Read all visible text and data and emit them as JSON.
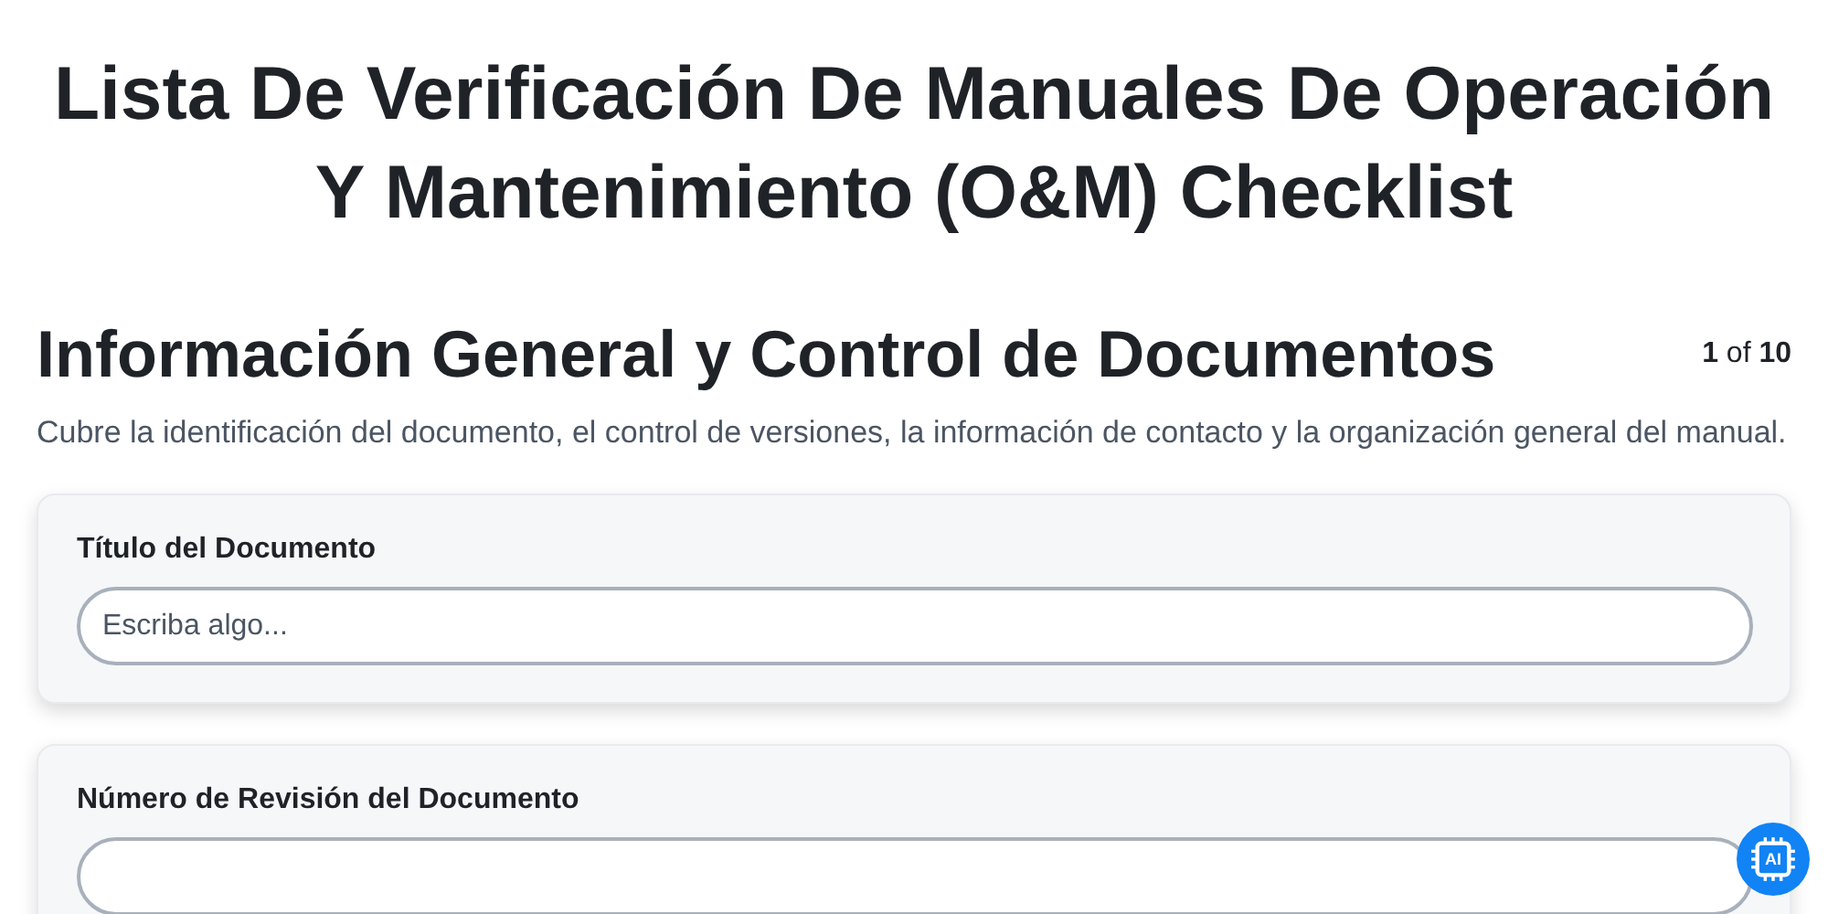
{
  "title": "Lista De Verificación De Manuales De Operación Y Mantenimiento (O&M) Checklist",
  "section": {
    "heading": "Información General y Control de Documentos",
    "progress": "**1** of **10**",
    "description": "Cubre la identificación del documento, el control de versiones, la información de contacto y la organización general del manual."
  },
  "questions": [
    {
      "label": "Título del Documento",
      "placeholder": "Escriba algo..."
    },
    {
      "label": "Número de Revisión del Documento"
    }
  ],
  "ai_button": {
    "label": "AI"
  }
}
